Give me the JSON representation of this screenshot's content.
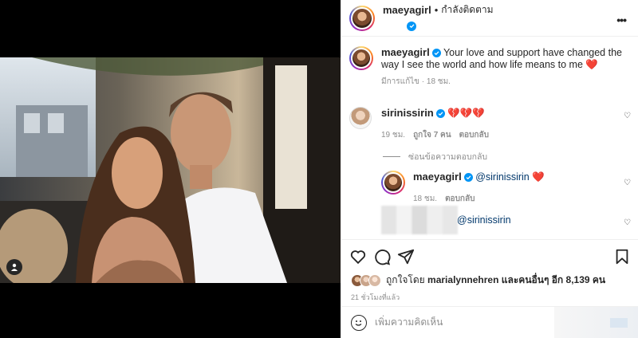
{
  "post": {
    "username": "maeyagirl",
    "separator": "•",
    "follow_state": "กำลังติดตาม",
    "more_label": "•••"
  },
  "caption": {
    "username": "maeyagirl",
    "text": "Your love and support have changed the way I see the world and how life means to me",
    "emoji": "❤️",
    "edited": "มีการแก้ไข · 18 ชม."
  },
  "comments": [
    {
      "username": "sirinissirin",
      "text": "💔💔💔",
      "time": "19 ชม.",
      "likes": "ถูกใจ 7 คน",
      "reply": "ตอบกลับ"
    }
  ],
  "hide_replies": "ซ่อนข้อความตอบกลับ",
  "replies": [
    {
      "username": "maeyagirl",
      "mention": "@sirinissirin",
      "emoji": "❤️",
      "time": "18 ชม.",
      "reply": "ตอบกลับ"
    },
    {
      "mention": "@sirinissirin"
    }
  ],
  "likes": {
    "prefix": "ถูกใจโดย",
    "user": "marialynnehren",
    "suffix": "และคนอื่นๆ อีก 8,139 คน"
  },
  "time_ago": "21 ชั่วโมงที่แล้ว",
  "add_comment": {
    "placeholder": "เพิ่มความคิดเห็น"
  },
  "colors": {
    "verified": "#0095f6",
    "heart": "#ed4956",
    "link": "#00376b",
    "muted": "#8e8e8e"
  }
}
